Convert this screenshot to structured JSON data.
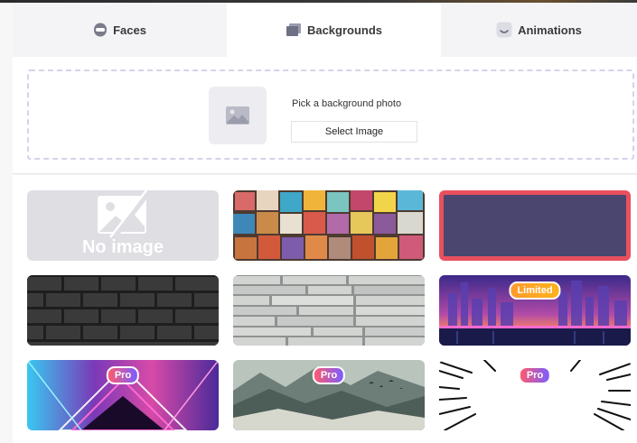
{
  "tabs": [
    {
      "label": "Faces",
      "icon": "face-icon"
    },
    {
      "label": "Backgrounds",
      "icon": "folder-stack-icon"
    },
    {
      "label": "Animations",
      "icon": "smile-icon"
    }
  ],
  "upload": {
    "prompt": "Pick a background photo",
    "button_label": "Select Image"
  },
  "cards": [
    {
      "id": "none",
      "text": "No image",
      "badge": ""
    },
    {
      "id": "colorful-blocks",
      "badge": ""
    },
    {
      "id": "purple-plain",
      "badge": "",
      "selected": true
    },
    {
      "id": "black-brick",
      "badge": ""
    },
    {
      "id": "stone-wall",
      "badge": ""
    },
    {
      "id": "neon-city",
      "badge": "Limited"
    },
    {
      "id": "neon-tunnel",
      "badge": "Pro"
    },
    {
      "id": "misty-mountains",
      "badge": "Pro"
    },
    {
      "id": "speed-lines",
      "badge": "Pro"
    }
  ],
  "colors": {
    "selected_border": "#e9505e",
    "pro_gradient_start": "#ff5a6e",
    "pro_gradient_end": "#7a5cff",
    "limited": "#ffa126"
  }
}
